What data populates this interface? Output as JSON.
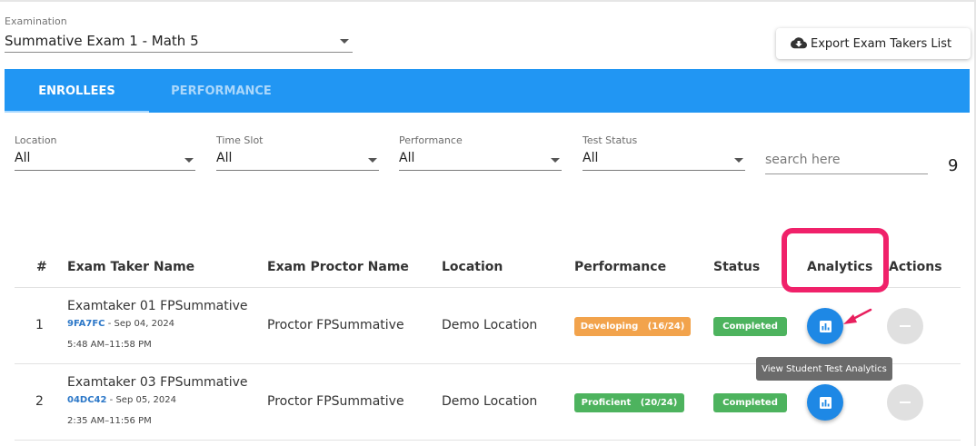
{
  "examination": {
    "label": "Examination",
    "value": "Summative Exam 1 - Math 5"
  },
  "export_button": {
    "label": "Export Exam Takers List",
    "icon": "cloud-download-icon"
  },
  "tabs": [
    {
      "label": "ENROLLEES",
      "active": true
    },
    {
      "label": "PERFORMANCE",
      "active": false
    }
  ],
  "filters": {
    "location": {
      "label": "Location",
      "value": "All"
    },
    "time_slot": {
      "label": "Time Slot",
      "value": "All"
    },
    "performance": {
      "label": "Performance",
      "value": "All"
    },
    "test_status": {
      "label": "Test Status",
      "value": "All"
    }
  },
  "search": {
    "placeholder": "search here"
  },
  "result_count": "9",
  "table": {
    "headers": {
      "index": "#",
      "taker": "Exam Taker Name",
      "proctor": "Exam Proctor Name",
      "location": "Location",
      "performance": "Performance",
      "status": "Status",
      "analytics": "Analytics",
      "actions": "Actions"
    },
    "rows": [
      {
        "index": "1",
        "name": "Examtaker 01 FPSummative",
        "code": "9FA7FC",
        "date": " - Sep 04, 2024",
        "time": "5:48 AM–11:58 PM",
        "proctor": "Proctor FPSummative",
        "location": "Demo Location",
        "performance": "Developing   (16/24)",
        "performance_color": "#f2a34c",
        "status": "Completed",
        "status_color": "#4db35e"
      },
      {
        "index": "2",
        "name": "Examtaker 03 FPSummative",
        "code": "04DC42",
        "date": " - Sep 05, 2024",
        "time": "2:35 AM–11:56 PM",
        "proctor": "Proctor FPSummative",
        "location": "Demo Location",
        "performance": "Proficient   (20/24)",
        "performance_color": "#4db35e",
        "status": "Completed",
        "status_color": "#4db35e"
      }
    ]
  },
  "tooltip": "View Student Test Analytics",
  "colors": {
    "primary": "#2196f3",
    "analytics_button": "#1e88e5",
    "highlight": "#f0216a",
    "developing": "#f2a34c",
    "proficient": "#4db35e"
  }
}
